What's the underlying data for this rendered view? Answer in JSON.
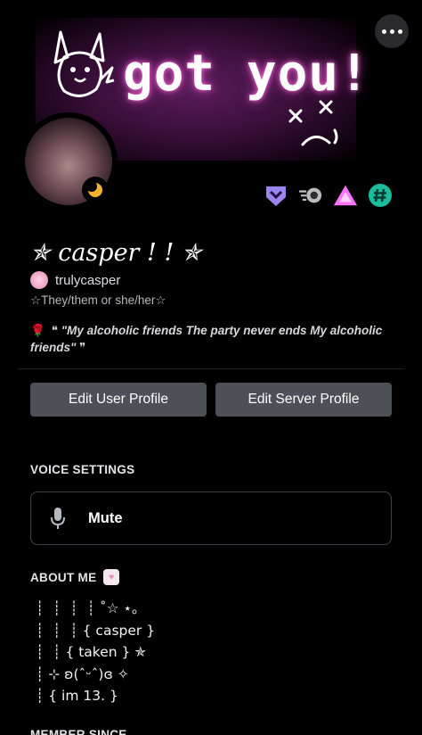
{
  "banner": {
    "text": "got you!",
    "face_text": "x x",
    "colors": {
      "glow": "#ff6bd6",
      "bg": "#3a0f3a"
    }
  },
  "header": {
    "menu_icon": "more-horizontal-icon"
  },
  "profile": {
    "display_name": "✯ casper ! ! ✯",
    "username": "trulycasper",
    "pronouns": "☆They/them or she/her☆",
    "status_emoji": "🌹",
    "custom_status": "❝ \"My alcoholic friends The party never ends My alcoholic friends\" ❞",
    "presence": "idle",
    "badges": [
      {
        "name": "hypesquad-badge",
        "color": "#9c84ef"
      },
      {
        "name": "nitro-badge",
        "color": "#b9bbbe"
      },
      {
        "name": "boost-badge",
        "color": "#ff73fa"
      },
      {
        "name": "hashtag-badge",
        "color": "#1abc9c"
      }
    ]
  },
  "actions": {
    "edit_user_profile": "Edit User Profile",
    "edit_server_profile": "Edit Server Profile"
  },
  "voice_settings": {
    "title": "VOICE SETTINGS",
    "mute_label": "Mute"
  },
  "about_me": {
    "title": "ABOUT ME",
    "lines": [
      "┊  ┊  ┊  ┊ ˚☆ ⋆｡",
      "┊  ┊  ┊ { casper }",
      "┊  ┊ { taken } ✯",
      "┊ ⊹ ʚ(ˆᵕˆ)ɞ ✧",
      "┊ { im 13. }"
    ]
  },
  "member_since": {
    "title": "MEMBER SINCE"
  }
}
